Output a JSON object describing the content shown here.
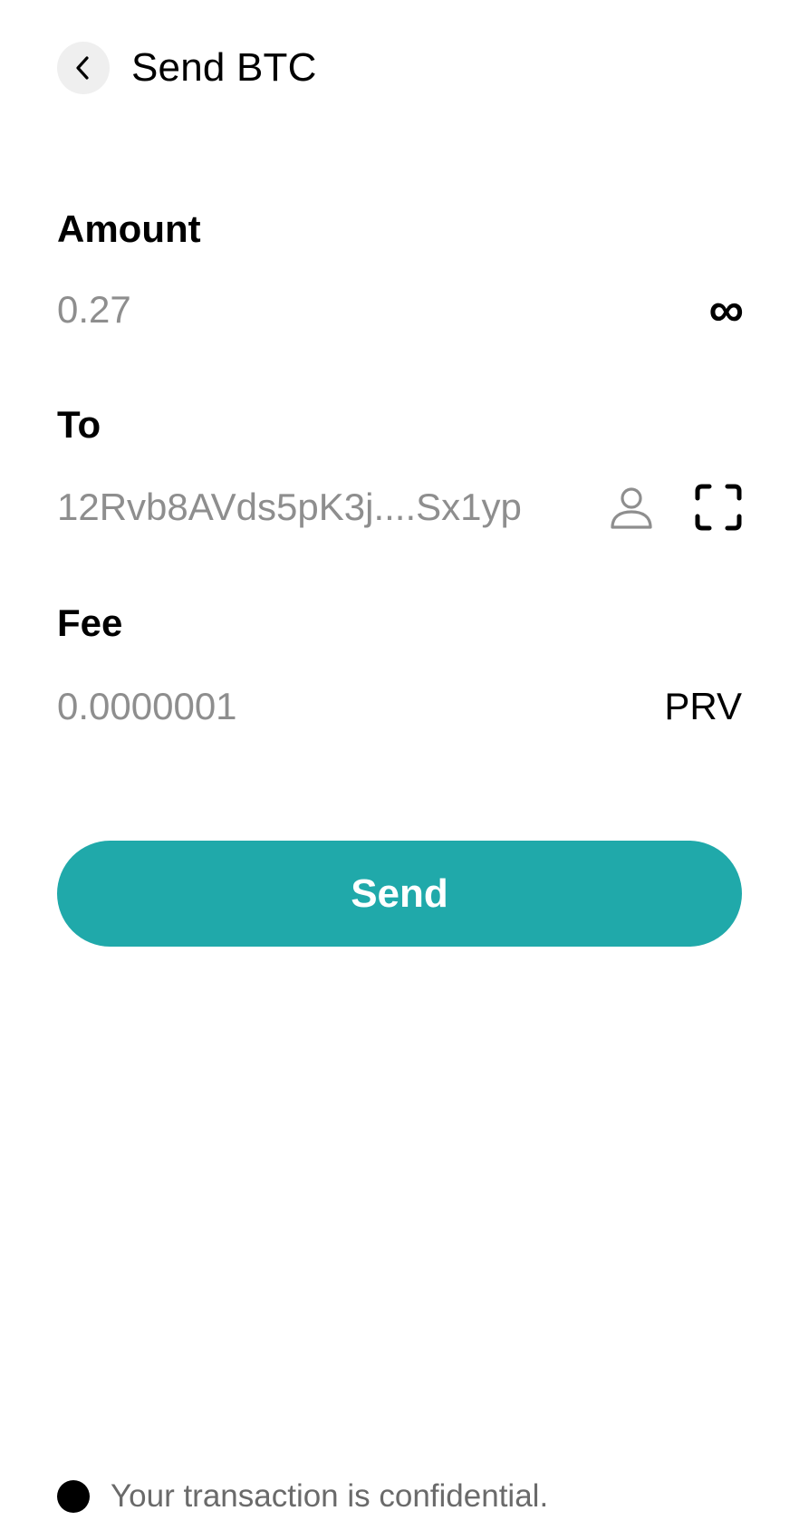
{
  "header": {
    "title": "Send BTC",
    "back_icon": "chevron-left-icon"
  },
  "amount": {
    "label": "Amount",
    "value": "0.27",
    "max_icon": "infinity-icon",
    "max_glyph": "∞"
  },
  "to": {
    "label": "To",
    "value": "12Rvb8AVds5pK3j....Sx1yp",
    "contact_icon": "person-icon",
    "scan_icon": "qr-scan-icon"
  },
  "fee": {
    "label": "Fee",
    "value": "0.0000001",
    "unit": "PRV"
  },
  "send_button": {
    "label": "Send"
  },
  "footer": {
    "note": "Your transaction is confidential."
  },
  "colors": {
    "accent": "#20a9aa",
    "muted_text": "#8e8e8e",
    "back_button_bg": "#efefef"
  }
}
